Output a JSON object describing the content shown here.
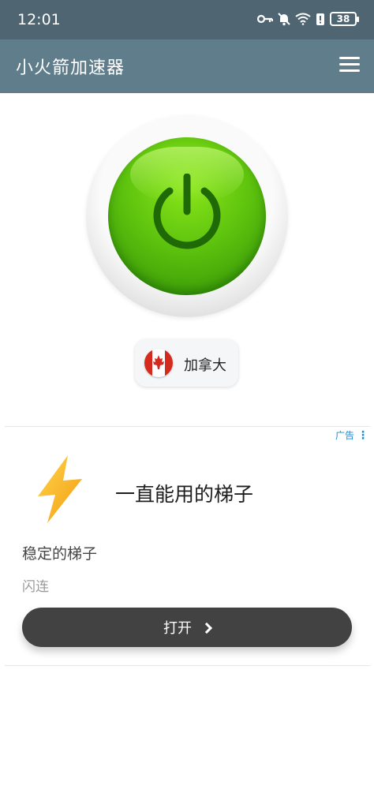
{
  "status_bar": {
    "time": "12:01",
    "battery": "38",
    "icons": [
      "key-icon",
      "bell-off-icon",
      "wifi-icon",
      "battery-alert-icon"
    ]
  },
  "app_bar": {
    "title": "小火箭加速器",
    "menu_icon": "hamburger-menu-icon"
  },
  "power": {
    "icon": "power-icon",
    "color": "#5fc40e"
  },
  "location": {
    "country": "加拿大",
    "flag_icon": "canada-flag-icon"
  },
  "ad": {
    "label": "广告",
    "title": "一直能用的梯子",
    "description": "稳定的梯子",
    "brand": "闪连",
    "button_label": "打开",
    "icon": "lightning-bolt-icon"
  }
}
